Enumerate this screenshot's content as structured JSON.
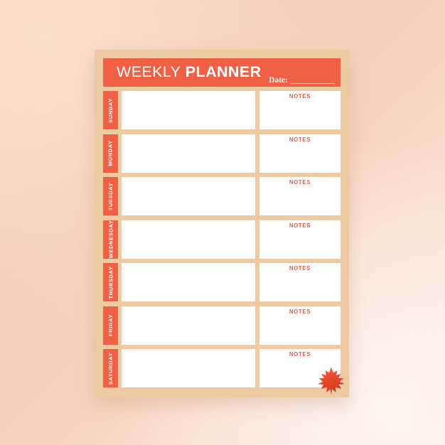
{
  "theme": {
    "accent_orange": "#ef6044",
    "card_tan": "#eecaa2",
    "notes_red": "#e2604a",
    "paper_white": "#ffffff",
    "background_peach": "#f9d3c0"
  },
  "header": {
    "title_light": "WEEKLY",
    "title_bold": "PLANNER",
    "date_label": "Date:"
  },
  "rows": [
    {
      "day": "SUNDAY",
      "notes_label": "NOTES",
      "main_value": "",
      "notes_value": ""
    },
    {
      "day": "MONDAY",
      "notes_label": "NOTES",
      "main_value": "",
      "notes_value": ""
    },
    {
      "day": "TUESDAY",
      "notes_label": "NOTES",
      "main_value": "",
      "notes_value": ""
    },
    {
      "day": "WEDNESDAY",
      "notes_label": "NOTES",
      "main_value": "",
      "notes_value": ""
    },
    {
      "day": "THURSDAY",
      "notes_label": "NOTES",
      "main_value": "",
      "notes_value": ""
    },
    {
      "day": "FRIDAY",
      "notes_label": "NOTES",
      "main_value": "",
      "notes_value": ""
    },
    {
      "day": "SATURDAY",
      "notes_label": "NOTES",
      "main_value": "",
      "notes_value": ""
    }
  ],
  "decoration": {
    "leaf_icon": "maple-leaf-icon",
    "leaf_color_light": "#f4623a",
    "leaf_color_dark": "#cf3b25"
  }
}
